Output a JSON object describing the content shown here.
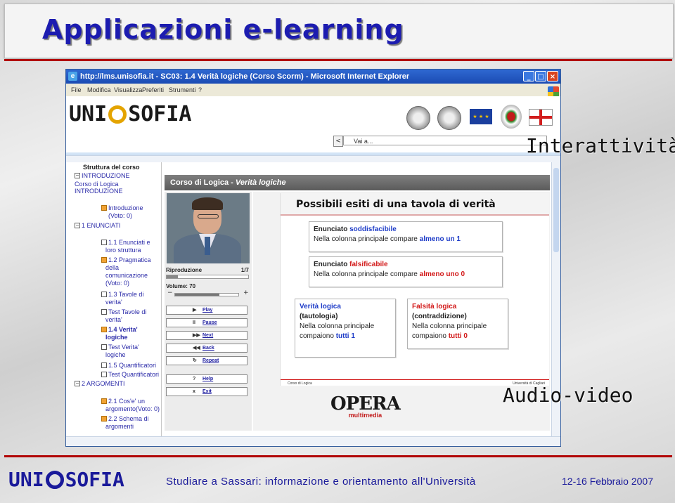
{
  "slide": {
    "title": "Applicazioni e-learning",
    "label_interactivity": "Interattività",
    "label_audio_video": "Audio-video"
  },
  "browser": {
    "window_title": "http://lms.unisofia.it - SC03: 1.4 Verità logiche (Corso Scorm) - Microsoft Internet Explorer",
    "menu": [
      "File",
      "Modifica",
      "Visualizza",
      "Preferiti",
      "Strumenti",
      "?"
    ],
    "nav_back": "<",
    "goto_label": "Vai a...",
    "brand_left": "UNI",
    "brand_right": "SOFIA"
  },
  "sidebar": {
    "heading": "Struttura del corso",
    "items": [
      {
        "text": "INTRODUZIONE"
      },
      {
        "text": "Corso di Logica"
      },
      {
        "text": "INTRODUZIONE"
      },
      {
        "text": "Introduzione"
      },
      {
        "text": "(Voto: 0)"
      },
      {
        "text": "1 ENUNCIATI"
      },
      {
        "text": "1.1 Enunciati e"
      },
      {
        "text": "loro struttura"
      },
      {
        "text": "1.2 Pragmatica"
      },
      {
        "text": "della"
      },
      {
        "text": "comunicazione"
      },
      {
        "text": "(Voto: 0)"
      },
      {
        "text": "1.3 Tavole di"
      },
      {
        "text": "verita'"
      },
      {
        "text": "Test Tavole di"
      },
      {
        "text": "verita'"
      },
      {
        "text": "1.4 Verita'"
      },
      {
        "text": "logiche"
      },
      {
        "text": "Test Verita'"
      },
      {
        "text": "logiche"
      },
      {
        "text": "1.5 Quantificatori"
      },
      {
        "text": "Test Quantificatori"
      },
      {
        "text": "2 ARGOMENTI"
      },
      {
        "text": "2.1 Cos'e' un"
      },
      {
        "text": "argomento(Voto: 0)"
      },
      {
        "text": "2.2 Schema di"
      },
      {
        "text": "argomenti"
      }
    ]
  },
  "course": {
    "bar_prefix": "Corso di Logica - ",
    "bar_topic": "Verità logiche"
  },
  "player": {
    "progress_label": "Riproduzione",
    "progress_count": "1/7",
    "progress_fraction": 0.14,
    "volume_label": "Volume: 70",
    "volume_fraction": 0.7,
    "vol_minus": "−",
    "vol_plus": "+",
    "buttons": [
      {
        "icon": "▶",
        "label": "Play"
      },
      {
        "icon": "II",
        "label": "Pause"
      },
      {
        "icon": "▶▶",
        "label": "Next"
      },
      {
        "icon": "◀◀",
        "label": "Back"
      },
      {
        "icon": "↻",
        "label": "Repeat"
      },
      {
        "icon": "?",
        "label": "Help"
      },
      {
        "icon": "x",
        "label": "Exit"
      }
    ]
  },
  "lesson": {
    "heading": "Possibili esiti di una tavola di verità",
    "box1_a": "Enunciato ",
    "box1_b": "soddisfacibile",
    "box1_c": "Nella colonna principale compare ",
    "box1_d": "almeno un 1",
    "box2_a": "Enunciato ",
    "box2_b": "falsificabile",
    "box2_c": "Nella colonna principale compare ",
    "box2_d": "almeno uno 0",
    "box3_a": "Verità logica",
    "box3_b": "(tautologia)",
    "box3_c": "Nella colonna principale",
    "box3_d": "compaiono ",
    "box3_e": "tutti 1",
    "box4_a": "Falsità logica",
    "box4_b": "(contraddizione)",
    "box4_c": "Nella colonna principale",
    "box4_d": "compaiono ",
    "box4_e": "tutti 0",
    "footer_left": "Corso di Logica",
    "footer_right": "Università di Cagliari"
  },
  "opera": {
    "name": "OPERA",
    "sub": "multimedia"
  },
  "footer": {
    "brand_left": "UNI",
    "brand_right": "SOFIA",
    "center": "Studiare a Sassari: informazione e orientamento all'Università",
    "date": "12-16 Febbraio 2007"
  },
  "colors": {
    "title_blue": "#1c1cb0",
    "accent_red": "#b10000",
    "footer_blue": "#1a1a9a"
  }
}
